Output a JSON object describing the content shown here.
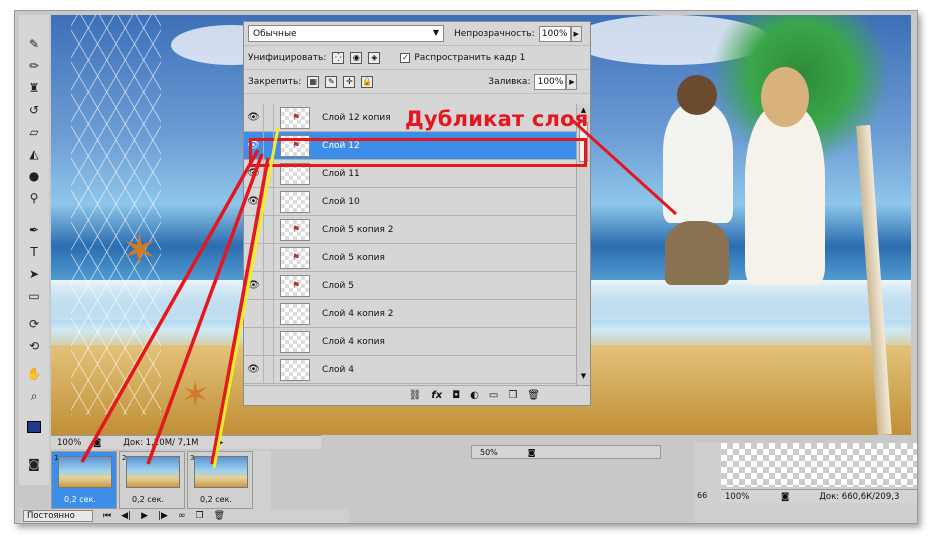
{
  "tools": [
    "brush-icon",
    "pencil-icon",
    "clone-stamp-icon",
    "history-brush-icon",
    "eraser-icon",
    "paint-bucket-icon",
    "blur-icon",
    "dodge-icon",
    "pen-icon",
    "type-icon",
    "path-select-icon",
    "rectangle-icon",
    "3d-rotate-icon",
    "3d-orbit-icon",
    "hand-icon",
    "zoom-icon"
  ],
  "canvas": {
    "zoom": "100%",
    "doc_info": "Док: 1,20М/ 7,1М"
  },
  "layers_panel": {
    "blend_mode": "Обычные",
    "opacity_label": "Непрозрачность:",
    "opacity_value": "100%",
    "unify_label": "Унифицировать:",
    "propagate_label": "Распространить кадр 1",
    "lock_label": "Закрепить:",
    "fill_label": "Заливка:",
    "fill_value": "100%",
    "layers": [
      {
        "name": "Слой 12 копия",
        "visible": true,
        "selected": false
      },
      {
        "name": "Слой 12",
        "visible": true,
        "selected": true
      },
      {
        "name": "Слой 11",
        "visible": true,
        "selected": false
      },
      {
        "name": "Слой 10",
        "visible": true,
        "selected": false
      },
      {
        "name": "Слой 5 копия 2",
        "visible": false,
        "selected": false
      },
      {
        "name": "Слой 5 копия",
        "visible": false,
        "selected": false
      },
      {
        "name": "Слой 5",
        "visible": true,
        "selected": false
      },
      {
        "name": "Слой 4 копия 2",
        "visible": false,
        "selected": false
      },
      {
        "name": "Слой 4 копия",
        "visible": false,
        "selected": false
      },
      {
        "name": "Слой 4",
        "visible": true,
        "selected": false
      }
    ],
    "footer_icons": [
      "link-icon",
      "fx-icon",
      "mask-icon",
      "adjustment-icon",
      "folder-icon",
      "new-layer-icon",
      "trash-icon"
    ]
  },
  "annotation": {
    "callout": "Дубликат слоя",
    "accent": "#e5161d",
    "yellow": "#f4ec24"
  },
  "animation": {
    "frames": [
      {
        "num": "1",
        "time": "0,2 сек.",
        "active": true
      },
      {
        "num": "2",
        "time": "0,2 сек.",
        "active": false
      },
      {
        "num": "3",
        "time": "0,2 сек.",
        "active": false
      }
    ],
    "loop": "Постоянно"
  },
  "doc2": {
    "zoom": "100%",
    "doc_info": "Док: 660,6К/209,3",
    "left_num": "66"
  },
  "doc3": {
    "zoom": "50%"
  }
}
